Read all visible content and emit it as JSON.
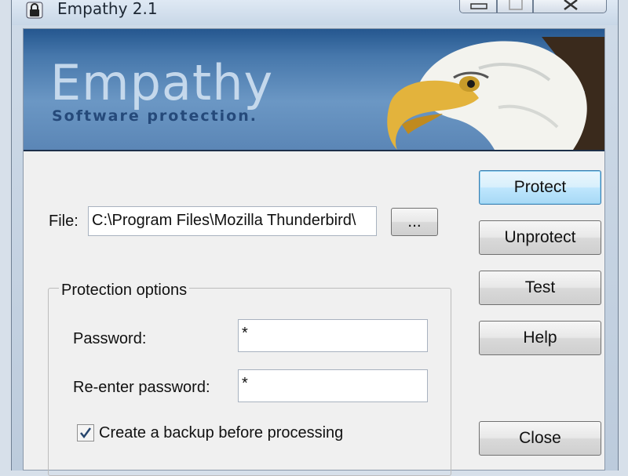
{
  "window": {
    "title": "Empathy 2.1"
  },
  "banner": {
    "brand": "Empathy",
    "tagline": "Software protection."
  },
  "file": {
    "label": "File:",
    "value": "C:\\Program Files\\Mozilla Thunderbird\\",
    "browse_label": "..."
  },
  "protection": {
    "group_title": "Protection options",
    "password_label": "Password:",
    "password_value": "*",
    "reenter_label": "Re-enter password:",
    "reenter_value": "*",
    "backup_label": "Create a backup before processing",
    "backup_checked": true
  },
  "buttons": {
    "protect": "Protect",
    "unprotect": "Unprotect",
    "test": "Test",
    "help": "Help",
    "close": "Close"
  },
  "icons": [
    "lock-icon",
    "minimize-icon",
    "maximize-icon",
    "close-icon",
    "checkmark-icon",
    "eagle-image"
  ]
}
